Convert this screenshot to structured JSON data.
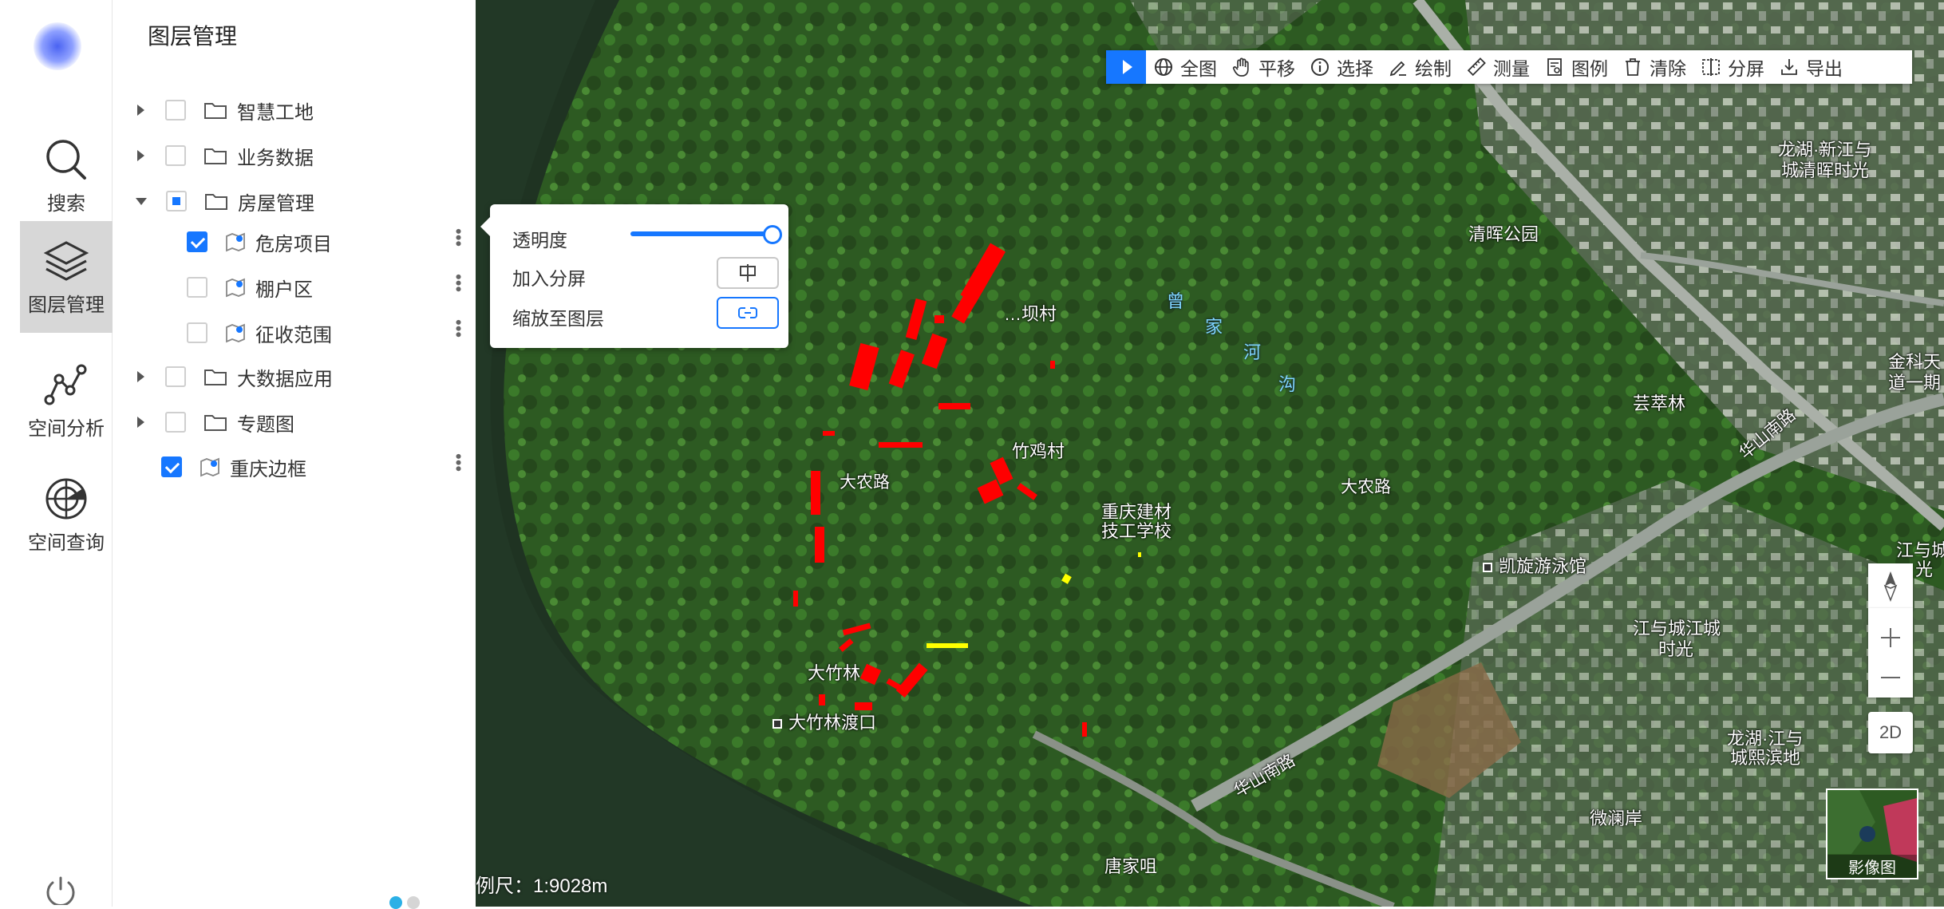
{
  "rail": {
    "items": [
      {
        "label": "搜索",
        "icon": "search-icon"
      },
      {
        "label": "图层管理",
        "icon": "layers-icon"
      },
      {
        "label": "空间分析",
        "icon": "analysis-icon"
      },
      {
        "label": "空间查询",
        "icon": "radar-icon"
      }
    ],
    "active": "图层管理"
  },
  "panel": {
    "title": "图层管理",
    "tree": [
      {
        "label": "智慧工地",
        "type": "folder",
        "expanded": false,
        "checked": "none"
      },
      {
        "label": "业务数据",
        "type": "folder",
        "expanded": false,
        "checked": "none"
      },
      {
        "label": "房屋管理",
        "type": "folder",
        "expanded": true,
        "checked": "partial"
      },
      {
        "label": "危房项目",
        "type": "layer",
        "checked": "checked"
      },
      {
        "label": "棚户区",
        "type": "layer",
        "checked": "none"
      },
      {
        "label": "征收范围",
        "type": "layer",
        "checked": "none"
      },
      {
        "label": "大数据应用",
        "type": "folder",
        "expanded": false,
        "checked": "none"
      },
      {
        "label": "专题图",
        "type": "folder",
        "expanded": false,
        "checked": "none"
      },
      {
        "label": "重庆边框",
        "type": "layer",
        "checked": "checked"
      }
    ]
  },
  "toolbar": {
    "items": [
      {
        "label": "全图",
        "icon": "globe-icon"
      },
      {
        "label": "平移",
        "icon": "hand-icon"
      },
      {
        "label": "选择",
        "icon": "info-icon"
      },
      {
        "label": "绘制",
        "icon": "pen-icon"
      },
      {
        "label": "测量",
        "icon": "ruler-icon"
      },
      {
        "label": "图例",
        "icon": "legend-icon"
      },
      {
        "label": "清除",
        "icon": "trash-icon"
      },
      {
        "label": "分屏",
        "icon": "split-icon"
      },
      {
        "label": "导出",
        "icon": "export-icon"
      }
    ]
  },
  "popup": {
    "opacity_label": "透明度",
    "opacity_value": 1.0,
    "split_label": "加入分屏",
    "zoom_label": "缩放至图层"
  },
  "map": {
    "labels": {
      "qinghui": "清晖公园",
      "longhu1": "龙湖·新江与",
      "longhu2": "城清晖时光",
      "zengjia1": "曾",
      "zengjia2": "家",
      "zengjia3": "河",
      "zengjia4": "沟",
      "yunzhilin": "芸萃林",
      "huashan1": "华山南路",
      "dazhulu1": "大农路",
      "dazhulu2": "大农路",
      "zhujicun": "竹鸡村",
      "xucun": "…坝村",
      "school1": "重庆建材",
      "school2": "技工学校",
      "kaixuan": "凯旋游泳馆",
      "jiangyu1": "江与城江城",
      "jiangyu2": "时光",
      "dazhulin": "大竹林",
      "dazhulinferry": "大竹林渡口",
      "huashan2": "华山南路",
      "longhu3": "龙湖·江与",
      "longhu4": "城熙滨地",
      "weilan": "微澜岸",
      "tangjiazui": "唐家咀",
      "jinke1": "金科天",
      "jinke2": "道一期",
      "jiangyu3": "江与城",
      "jiangyu4": "光"
    },
    "scale_text": "例尺：1:9028m",
    "view_mode": "2D",
    "basemap_label": "影像图",
    "colors": {
      "danger_buildings": "#ff0000",
      "highlight": "#ffff00",
      "accent": "#1677ff"
    }
  }
}
